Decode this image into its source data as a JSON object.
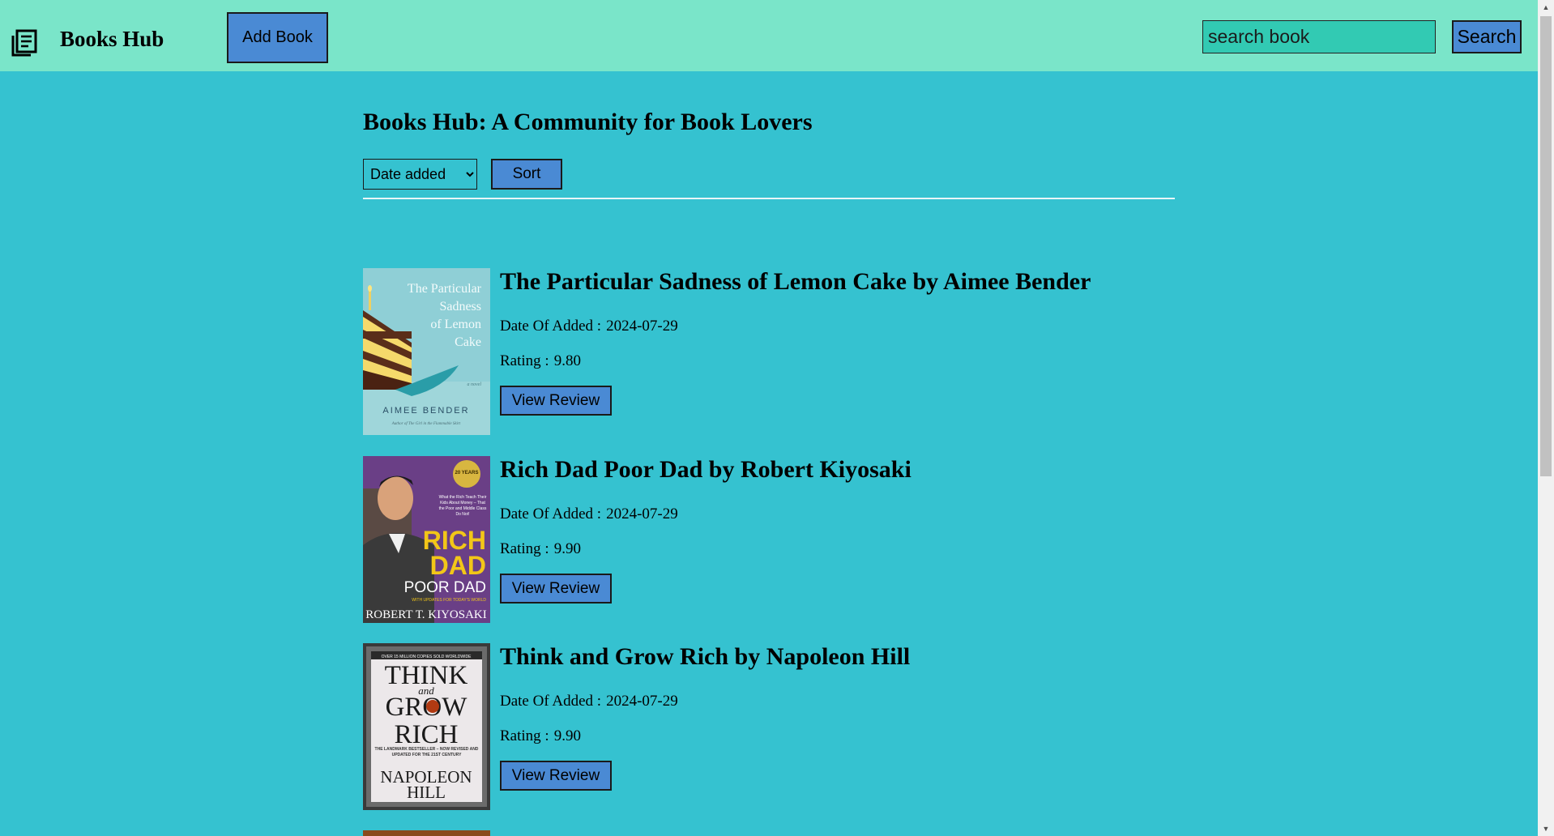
{
  "navbar": {
    "brand": "Books Hub",
    "add_book_label": "Add Book",
    "search_placeholder": "search book",
    "search_label": "Search"
  },
  "main": {
    "title": "Books Hub: A Community for Book Lovers",
    "sort": {
      "selected": "Date added",
      "button_label": "Sort"
    },
    "date_label": "Date Of Added :",
    "rating_label": "Rating :",
    "review_label": "View Review",
    "books": [
      {
        "title": "The Particular Sadness of Lemon Cake by Aimee Bender",
        "date": "2024-07-29",
        "rating": "9.80",
        "cover": {
          "title_lines": [
            "The Particular",
            "Sadness",
            "of Lemon",
            "Cake"
          ],
          "subtitle": "a novel",
          "author": "AIMEE BENDER",
          "tagline": "Author of The Girl in the Flammable Skirt"
        }
      },
      {
        "title": "Rich Dad Poor Dad by Robert Kiyosaki",
        "date": "2024-07-29",
        "rating": "9.90",
        "cover": {
          "badge": "20 YEARS",
          "blurb": "What the Rich Teach Their Kids About Money – That the Poor and Middle Class Do Not!",
          "word1": "RICH",
          "word2": "DAD",
          "word3": "POOR DAD",
          "strap": "WITH UPDATES FOR TODAY'S WORLD",
          "author": "ROBERT T. KIYOSAKI"
        }
      },
      {
        "title": "Think and Grow Rich by Napoleon Hill",
        "date": "2024-07-29",
        "rating": "9.90",
        "cover": {
          "top": "OVER 15 MILLION COPIES SOLD WORLDWIDE",
          "line1": "THINK",
          "line2": "and",
          "line3": "GROW",
          "line4": "RICH",
          "sub": "THE LANDMARK BESTSELLER – NOW REVISED AND UPDATED FOR THE 21ST CENTURY",
          "author1": "NAPOLEON",
          "author2": "HILL"
        }
      }
    ]
  },
  "colors": {
    "navbar": "#7ae5c9",
    "background": "#35c2d0",
    "button": "#4a8ad4",
    "search_input": "#32cab3"
  }
}
